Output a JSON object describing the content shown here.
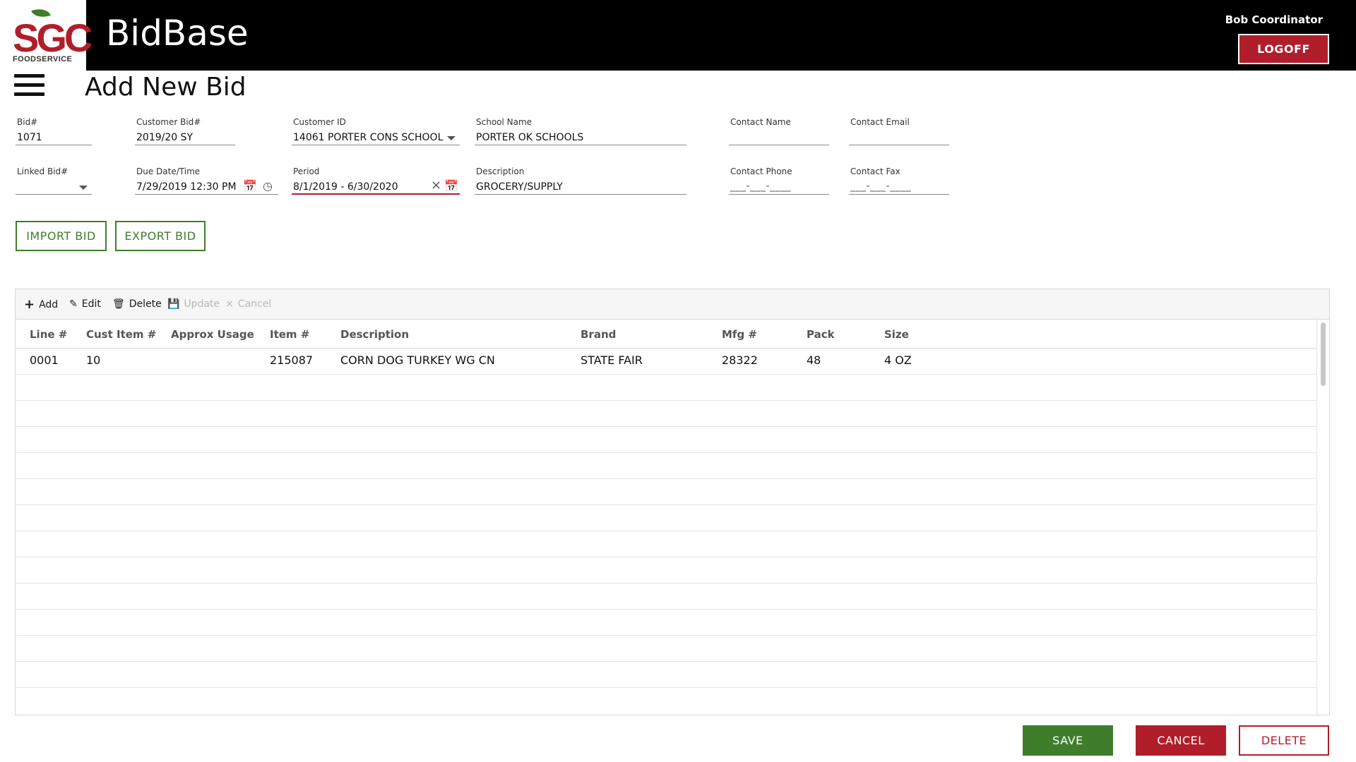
{
  "header": {
    "logo_text": "SGC",
    "logo_subtext": "FOODSERVICE",
    "app_title": "BidBase",
    "user_name": "Bob Coordinator",
    "logoff_label": "LOGOFF"
  },
  "page": {
    "title": "Add New Bid"
  },
  "form": {
    "bid_number": {
      "label": "Bid#",
      "value": "1071"
    },
    "customer_bid": {
      "label": "Customer Bid#",
      "value": "2019/20 SY"
    },
    "customer_id": {
      "label": "Customer ID",
      "value": "14061 PORTER CONS SCHOOL"
    },
    "school_name": {
      "label": "School Name",
      "value": "PORTER OK SCHOOLS"
    },
    "contact_name": {
      "label": "Contact Name",
      "value": ""
    },
    "contact_email": {
      "label": "Contact Email",
      "value": ""
    },
    "linked_bid": {
      "label": "Linked Bid#",
      "value": ""
    },
    "due_date": {
      "label": "Due Date/Time",
      "value": "7/29/2019  12:30 PM"
    },
    "period": {
      "label": "Period",
      "value": "8/1/2019 - 6/30/2020"
    },
    "description": {
      "label": "Description",
      "value": "GROCERY/SUPPLY"
    },
    "contact_phone": {
      "label": "Contact Phone",
      "mask": "___-___-____"
    },
    "contact_fax": {
      "label": "Contact Fax",
      "mask": "___-___-____"
    }
  },
  "actions": {
    "import_label": "IMPORT BID",
    "export_label": "EXPORT BID"
  },
  "grid": {
    "toolbar": {
      "add": "Add",
      "edit": "Edit",
      "delete": "Delete",
      "update": "Update",
      "cancel": "Cancel"
    },
    "columns": [
      "Line #",
      "Cust Item #",
      "Approx Usage",
      "Item #",
      "Description",
      "Brand",
      "Mfg #",
      "Pack",
      "Size"
    ],
    "rows": [
      [
        "0001",
        "10",
        "",
        "215087",
        "CORN DOG TURKEY WG CN",
        "STATE FAIR",
        "28322",
        "48",
        "4 OZ"
      ]
    ]
  },
  "footer": {
    "save_label": "SAVE",
    "cancel_label": "CANCEL",
    "delete_label": "DELETE"
  },
  "colors": {
    "brand_red": "#b01e2b",
    "brand_green": "#3f7d2c",
    "header_bg": "#000000"
  },
  "icons": {
    "menu": "hamburger-icon",
    "calendar": "calendar-icon",
    "clock": "clock-icon",
    "clear": "close-icon",
    "add": "plus-icon",
    "edit": "pencil-icon",
    "delete": "trash-icon",
    "update": "save-icon",
    "cancel": "close-icon"
  }
}
